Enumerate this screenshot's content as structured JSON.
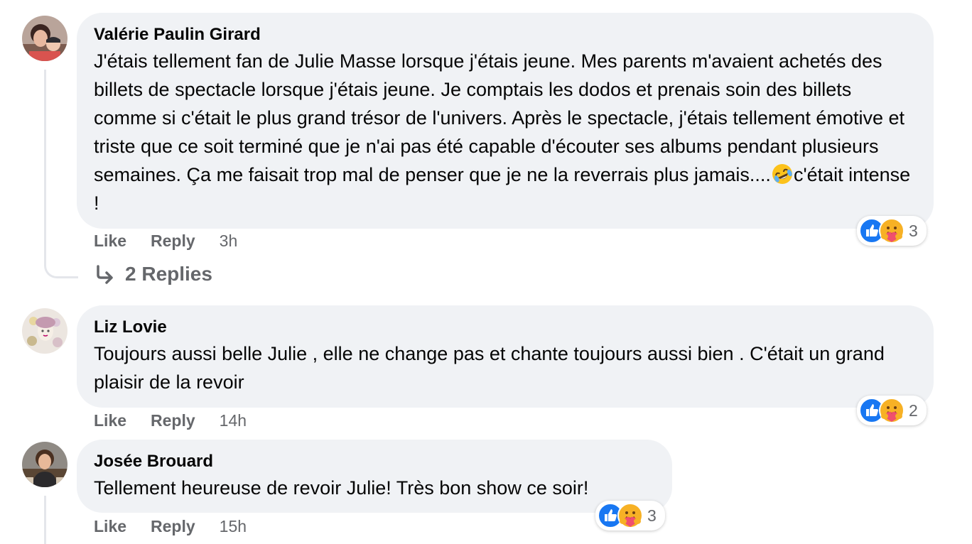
{
  "comments": [
    {
      "author": "Valérie Paulin Girard",
      "text_before_emoji": "J'étais tellement fan de Julie Masse lorsque j'étais jeune. Mes parents m'avaient achetés des billets de spectacle lorsque j'étais jeune. Je comptais les dodos et prenais soin des billets comme si c'était le plus grand trésor de l'univers. Après le spectacle, j'étais tellement émotive et triste que ce soit terminé que je n'ai pas été capable d'écouter ses albums pendant plusieurs semaines. Ça me faisait trop mal de penser que je ne la reverrais plus jamais....",
      "text_after_emoji": "c'était intense !",
      "inline_emoji": "rolling-on-floor-laughing",
      "like_label": "Like",
      "reply_label": "Reply",
      "time": "3h",
      "reactions": [
        "like",
        "care"
      ],
      "reaction_count": "3",
      "replies_label": "2 Replies"
    },
    {
      "author": "Liz Lovie",
      "text": "Toujours aussi belle Julie , elle ne change pas et chante toujours aussi bien . C'était un grand plaisir de la revoir",
      "like_label": "Like",
      "reply_label": "Reply",
      "time": "14h",
      "reactions": [
        "like",
        "care"
      ],
      "reaction_count": "2"
    },
    {
      "author": "Josée Brouard",
      "text": "Tellement heureuse de revoir Julie! Très bon show ce soir!",
      "like_label": "Like",
      "reply_label": "Reply",
      "time": "15h",
      "reactions": [
        "like",
        "care"
      ],
      "reaction_count": "3"
    }
  ],
  "colors": {
    "bubble": "#f0f2f5",
    "secondary_text": "#65676b",
    "like_blue": "#1877f2",
    "thread_line": "#e4e6eb"
  }
}
